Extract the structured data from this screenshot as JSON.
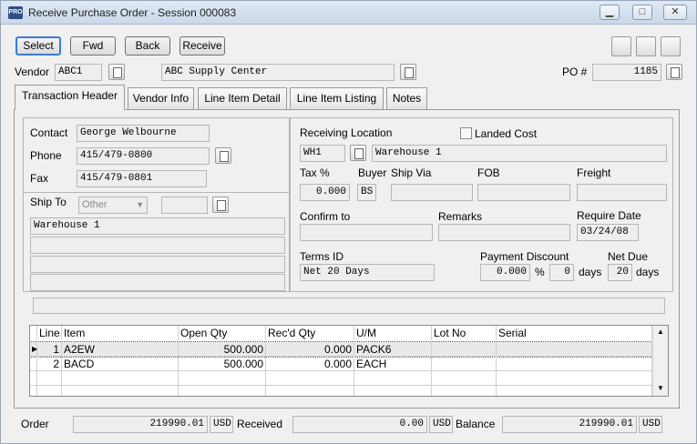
{
  "window": {
    "title": "Receive Purchase Order - Session 000083",
    "app_icon": "PRO"
  },
  "toolbar": {
    "select": "Select",
    "fwd": "Fwd",
    "back": "Back",
    "receive": "Receive"
  },
  "vendor": {
    "label": "Vendor",
    "code": "ABC1",
    "name": "ABC Supply Center",
    "po_label": "PO #",
    "po": "1185"
  },
  "tabs": [
    "Transaction Header",
    "Vendor Info",
    "Line Item Detail",
    "Line Item Listing",
    "Notes"
  ],
  "header": {
    "contact_label": "Contact",
    "contact": "George Welbourne",
    "phone_label": "Phone",
    "phone": "415/479-0800",
    "fax_label": "Fax",
    "fax": "415/479-0801",
    "shipto_label": "Ship To",
    "shipto_select": "Other",
    "ship_line1": "Warehouse 1",
    "recv_loc_label": "Receiving Location",
    "landed_cost_label": "Landed Cost",
    "recv_loc_code": "WH1",
    "recv_loc_name": "Warehouse 1",
    "tax_label": "Tax %",
    "tax": "0.000",
    "buyer_label": "Buyer",
    "buyer": "BS",
    "shipvia_label": "Ship Via",
    "fob_label": "FOB",
    "freight_label": "Freight",
    "confirm_label": "Confirm to",
    "remarks_label": "Remarks",
    "require_label": "Require Date",
    "require_date": "03/24/08",
    "terms_label": "Terms ID",
    "terms": "Net 20 Days",
    "paydisc_label": "Payment Discount",
    "paydisc": "0.000",
    "pct": "%",
    "days_val": "0",
    "days": "days",
    "netdue_label": "Net Due",
    "netdue": "20",
    "netdue_days": "days"
  },
  "grid": {
    "headers": [
      "Line",
      "Item",
      "Open Qty",
      "Rec'd Qty",
      "U/M",
      "Lot No",
      "Serial"
    ],
    "rows": [
      [
        "1",
        "A2EW",
        "500.000",
        "0.000",
        "PACK6"
      ],
      [
        "2",
        "BACD",
        "500.000",
        "0.000",
        "EACH"
      ]
    ]
  },
  "status": {
    "order_label": "Order",
    "order": "219990.01",
    "usd": "USD",
    "received_label": "Received",
    "received": "0.00",
    "balance_label": "Balance",
    "balance": "219990.01"
  }
}
